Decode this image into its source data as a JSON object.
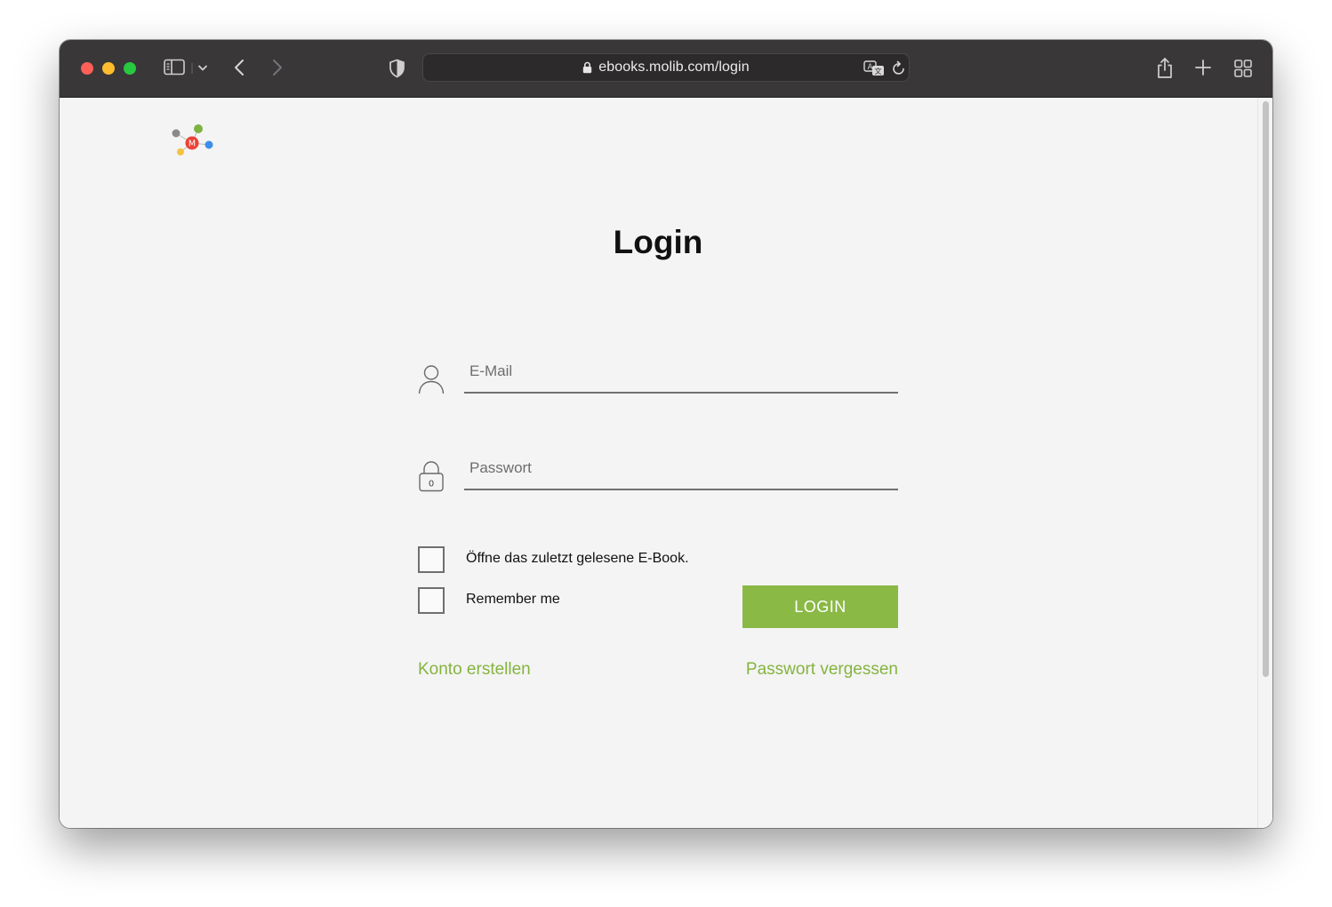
{
  "browser": {
    "url": "ebooks.molib.com/login",
    "icon_names": [
      "sidebar-icon",
      "chevron-down-icon",
      "back-icon",
      "forward-icon",
      "shield-icon",
      "lock-icon",
      "translate-icon",
      "reload-icon",
      "share-icon",
      "new-tab-icon",
      "tab-overview-icon"
    ]
  },
  "logo": {
    "letter": "M",
    "colors": [
      "#ea4335",
      "#7cb342",
      "#3b8ee8",
      "#f5c242",
      "#8a8a8a"
    ]
  },
  "login": {
    "title": "Login",
    "email_placeholder": "E-Mail",
    "email_value": "",
    "password_placeholder": "Passwort",
    "password_value": "",
    "lock_digit": "0",
    "open_last_ebook_label": "Öffne das zuletzt gelesene E-Book.",
    "remember_me_label": "Remember me",
    "login_button": "LOGIN",
    "create_account_link": "Konto erstellen",
    "forgot_password_link": "Passwort vergessen"
  },
  "colors": {
    "accent": "#8ab946",
    "link": "#85b43f",
    "toolbar": "#3a3739",
    "page_bg": "#f4f4f4"
  }
}
